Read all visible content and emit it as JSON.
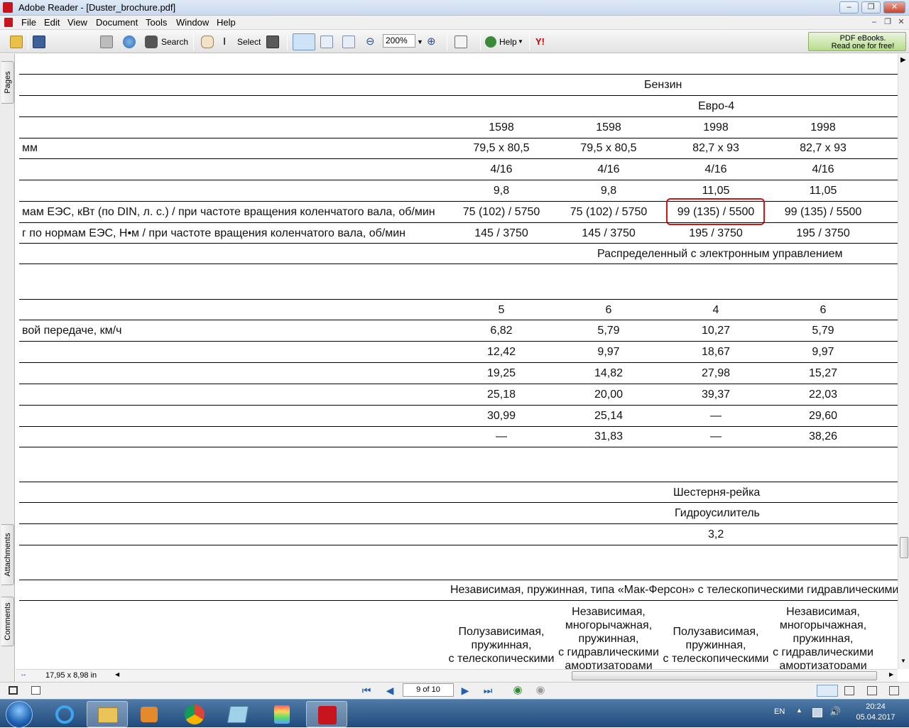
{
  "window": {
    "title": "Adobe Reader - [Duster_brochure.pdf]"
  },
  "menu": {
    "items": [
      "File",
      "Edit",
      "View",
      "Document",
      "Tools",
      "Window",
      "Help"
    ]
  },
  "toolbar": {
    "open_icon": "folder-open-icon",
    "save_copy_label": "Save a Copy",
    "search_label": "Search",
    "select_label": "Select",
    "zoom_value": "200%",
    "help_label": "Help",
    "promo_line1": "PDF eBooks.",
    "promo_line2": "Read one for free!"
  },
  "left_panel": {
    "tabs": [
      "Pages",
      "Attachments",
      "Comments"
    ]
  },
  "document": {
    "rows": [
      {
        "label": "",
        "values": [
          "Бензин"
        ]
      },
      {
        "label": "",
        "values": [
          "Евро-4"
        ]
      },
      {
        "label": "",
        "values": [
          "1598",
          "1598",
          "1998",
          "1998"
        ]
      },
      {
        "label": "мм",
        "values": [
          "79,5 x 80,5",
          "79,5 x 80,5",
          "82,7 x 93",
          "82,7 x 93"
        ]
      },
      {
        "label": "",
        "values": [
          "4/16",
          "4/16",
          "4/16",
          "4/16"
        ]
      },
      {
        "label": "",
        "values": [
          "9,8",
          "9,8",
          "11,05",
          "11,05"
        ]
      },
      {
        "label": "мам ЕЭС, кВт (по DIN, л. с.) / при частоте вращения коленчатого вала, об/мин",
        "values": [
          "75 (102) / 5750",
          "75 (102) / 5750",
          "99 (135) / 5500",
          "99 (135) / 5500"
        ]
      },
      {
        "label": "г по нормам ЕЭС, Н•м / при частоте вращения коленчатого вала, об/мин",
        "values": [
          "145 / 3750",
          "145 / 3750",
          "195 / 3750",
          "195 / 3750"
        ]
      },
      {
        "label": "",
        "values": [
          "Распределенный с электронным управлением"
        ]
      },
      {
        "label": "",
        "values": [
          "5",
          "6",
          "4",
          "6"
        ]
      },
      {
        "label": "вой передаче, км/ч",
        "values": [
          "6,82",
          "5,79",
          "10,27",
          "5,79"
        ]
      },
      {
        "label": "",
        "values": [
          "12,42",
          "9,97",
          "18,67",
          "9,97"
        ]
      },
      {
        "label": "",
        "values": [
          "19,25",
          "14,82",
          "27,98",
          "15,27"
        ]
      },
      {
        "label": "",
        "values": [
          "25,18",
          "20,00",
          "39,37",
          "22,03"
        ]
      },
      {
        "label": "",
        "values": [
          "30,99",
          "25,14",
          "—",
          "29,60"
        ]
      },
      {
        "label": "",
        "values": [
          "—",
          "31,83",
          "—",
          "38,26"
        ]
      },
      {
        "label": "",
        "values": [
          "Шестерня-рейка"
        ]
      },
      {
        "label": "",
        "values": [
          "Гидроусилитель"
        ]
      },
      {
        "label": "",
        "values": [
          "3,2"
        ]
      },
      {
        "label": "",
        "values": [
          "Независимая, пружинная, типа «Мак-Ферсон» с телескопическими гидравлическими а"
        ]
      },
      {
        "label": "",
        "values": [
          "Полузависимая,\nпружинная,\nс телескопическими",
          "Независимая,\nмногорычажная,\nпружинная,\nс гидравлическими\nамортизаторами",
          "Полузависимая,\nпружинная,\nс телескопическими",
          "Независимая,\nмногорычажная,\nпружинная,\nс гидравлическими\nамортизаторами"
        ]
      }
    ],
    "highlighted_value": "99 (135) / 5500"
  },
  "status": {
    "page_size": "17,95 x 8,98 in",
    "page_indicator": "9 of 10"
  },
  "taskbar": {
    "language": "EN",
    "time": "20:24",
    "date": "05.04.2017"
  },
  "colors": {
    "highlight_border": "#d21414",
    "title_bar": "#c9d9ee"
  }
}
